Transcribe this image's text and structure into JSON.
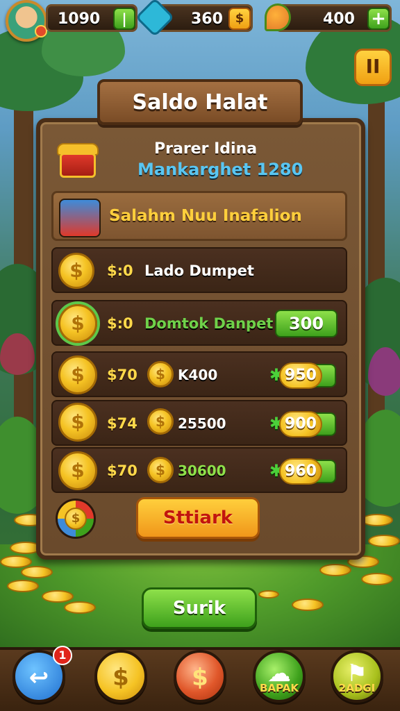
{
  "topbar": {
    "gold": "1090",
    "gems": "360",
    "leaves": "400"
  },
  "pause_label": "II",
  "panel": {
    "title": "Saldo Halat",
    "header_line1": "Prarer Idina",
    "header_line2": "Mankarghet 1280",
    "banner": "Salahm Nuu Inafalion",
    "rows": [
      {
        "price": "$:0",
        "name": "Lado Dumpet"
      },
      {
        "price": "$:0",
        "name": "Domtok Danpet",
        "button": "300"
      },
      {
        "price": "$70",
        "qty": "K400",
        "plus": "✱",
        "button": "950"
      },
      {
        "price": "$74",
        "qty": "25500",
        "plus": "✱",
        "button": "900"
      },
      {
        "price": "$70",
        "qty": "30600",
        "plus": "✱",
        "button": "960"
      }
    ],
    "start_button": "Sttiark"
  },
  "submit_button": "Surik",
  "bottom_nav": {
    "notification_count": "1",
    "items": [
      {
        "label": ""
      },
      {
        "label": ""
      },
      {
        "label": ""
      },
      {
        "label": "BAPAK"
      },
      {
        "label": "2ADGI"
      }
    ]
  },
  "colors": {
    "wood": "#7a5836",
    "gold": "#f5c324",
    "green_button": "#3ea11c",
    "orange_button": "#f0961a",
    "cyan_text": "#59c6f2"
  }
}
